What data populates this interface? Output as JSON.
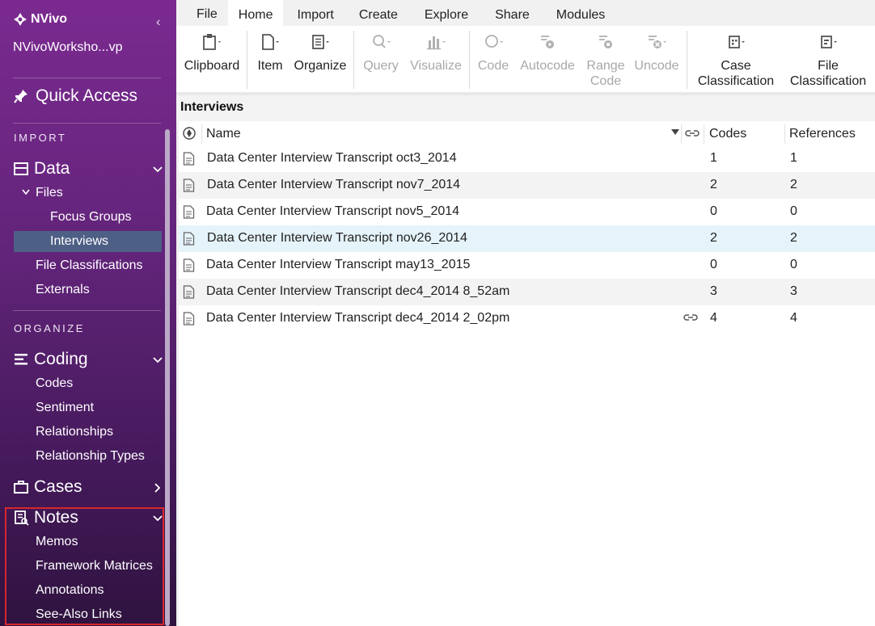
{
  "app": {
    "brand": "NVivo",
    "project": "NVivoWorksho...vp",
    "collapse_glyph": "‹",
    "accent_color": "#6b2586",
    "highlight_color": "#d8262f"
  },
  "sidebar": {
    "quick_access": "Quick Access",
    "import_label": "IMPORT",
    "data_label": "Data",
    "files_label": "Files",
    "focus_groups": "Focus Groups",
    "interviews": "Interviews",
    "file_classifications": "File Classifications",
    "externals": "Externals",
    "organize_label": "ORGANIZE",
    "coding_label": "Coding",
    "codes": "Codes",
    "sentiment": "Sentiment",
    "relationships": "Relationships",
    "relationship_types": "Relationship Types",
    "cases_label": "Cases",
    "notes_label": "Notes",
    "memos": "Memos",
    "framework_matrices": "Framework Matrices",
    "annotations": "Annotations",
    "see_also_links": "See-Also Links"
  },
  "ribbon": {
    "tabs": [
      "File",
      "Home",
      "Import",
      "Create",
      "Explore",
      "Share",
      "Modules"
    ],
    "active_tab": "Home",
    "buttons": {
      "clipboard": "Clipboard",
      "item": "Item",
      "organize": "Organize",
      "query": "Query",
      "visualize": "Visualize",
      "code": "Code",
      "autocode": "Autocode",
      "range_code_1": "Range",
      "range_code_2": "Code",
      "uncode": "Uncode",
      "case_class_1": "Case",
      "case_class_2": "Classification",
      "file_class_1": "File",
      "file_class_2": "Classification"
    }
  },
  "list": {
    "title": "Interviews",
    "columns": {
      "name": "Name",
      "codes": "Codes",
      "references": "References"
    },
    "rows": [
      {
        "name": "Data Center Interview Transcript oct3_2014",
        "codes": "1",
        "references": "1",
        "linked": false
      },
      {
        "name": "Data Center Interview Transcript nov7_2014",
        "codes": "2",
        "references": "2",
        "linked": false
      },
      {
        "name": "Data Center Interview Transcript nov5_2014",
        "codes": "0",
        "references": "0",
        "linked": false
      },
      {
        "name": "Data Center Interview Transcript nov26_2014",
        "codes": "2",
        "references": "2",
        "linked": false,
        "selected": true
      },
      {
        "name": "Data Center Interview Transcript may13_2015",
        "codes": "0",
        "references": "0",
        "linked": false
      },
      {
        "name": "Data Center Interview Transcript dec4_2014 8_52am",
        "codes": "3",
        "references": "3",
        "linked": false
      },
      {
        "name": "Data Center Interview Transcript dec4_2014 2_02pm",
        "codes": "4",
        "references": "4",
        "linked": true
      }
    ]
  }
}
